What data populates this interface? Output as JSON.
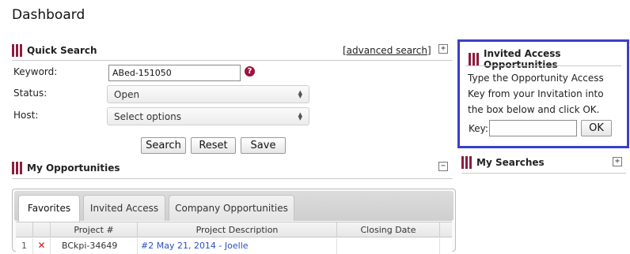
{
  "page": {
    "title": "Dashboard"
  },
  "quick_search": {
    "title": "Quick Search",
    "advanced_link": "[advanced search]",
    "expand_icon": "plus-box-icon",
    "keyword_label": "Keyword:",
    "keyword_value": "ABed-151050",
    "status_label": "Status:",
    "status_value": "Open",
    "host_label": "Host:",
    "host_value": "Select options",
    "buttons": {
      "search": "Search",
      "reset": "Reset",
      "save": "Save"
    }
  },
  "invited_access": {
    "title": "Invited Access Opportunities",
    "instructions": "Type the Opportunity Access Key from your Invitation into the box below and click OK.",
    "key_label": "Key:",
    "key_value": "",
    "ok_label": "OK",
    "border_color": "#3a3fc7"
  },
  "my_searches": {
    "title": "My Searches",
    "expand_icon": "plus-box-icon"
  },
  "my_opportunities": {
    "title": "My Opportunities",
    "collapse_icon": "minus-box-icon",
    "tabs": [
      {
        "label": "Favorites",
        "active": true
      },
      {
        "label": "Invited Access",
        "active": false
      },
      {
        "label": "Company Opportunities",
        "active": false
      }
    ],
    "columns": [
      "Project #",
      "Project Description",
      "Closing Date"
    ],
    "rows": [
      {
        "index": "1",
        "project": "BCkpi-34649",
        "description": "#2 May 21, 2014 - Joelle",
        "closing": ""
      }
    ]
  },
  "colors": {
    "brand_bars": "#8c1d3d",
    "help_icon": "#a0123e",
    "link": "#2a4fc0",
    "remove_x": "#dd1111"
  }
}
